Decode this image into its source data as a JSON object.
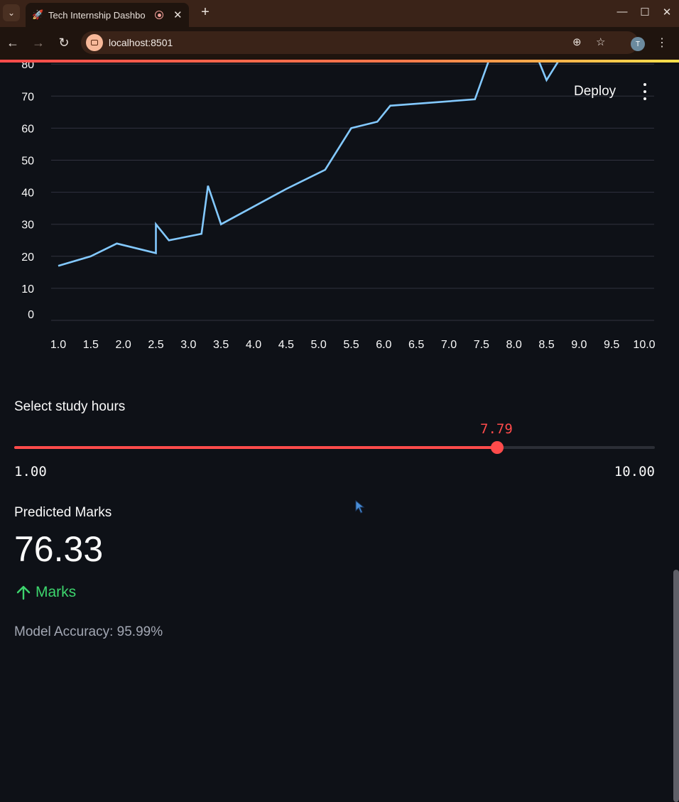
{
  "browser": {
    "tab_title": "Tech Internship Dashbo",
    "tab_favicon": "rocket-icon",
    "url": "localhost:8501",
    "profile_initial": "T"
  },
  "app": {
    "deploy_label": "Deploy"
  },
  "chart_data": {
    "type": "line",
    "x": [
      1.0,
      1.5,
      1.9,
      2.5,
      2.5,
      2.7,
      3.2,
      3.3,
      3.5,
      4.5,
      5.1,
      5.5,
      5.9,
      6.1,
      7.4,
      7.7,
      8.3,
      8.5,
      8.9
    ],
    "y": [
      17,
      20,
      24,
      21,
      30,
      25,
      27,
      42,
      30,
      41,
      47,
      60,
      62,
      67,
      69,
      86,
      85,
      75,
      88
    ],
    "xticks": [
      "1.0",
      "1.5",
      "2.0",
      "2.5",
      "3.0",
      "3.5",
      "4.0",
      "4.5",
      "5.0",
      "5.5",
      "6.0",
      "6.5",
      "7.0",
      "7.5",
      "8.0",
      "8.5",
      "9.0",
      "9.5",
      "10.0"
    ],
    "yticks": [
      "0",
      "10",
      "20",
      "30",
      "40",
      "50",
      "60",
      "70",
      "80"
    ],
    "xlim": [
      1.0,
      10.0
    ],
    "ylim": [
      0,
      80
    ],
    "grid": true,
    "color": "#83c9ff"
  },
  "slider": {
    "label": "Select study hours",
    "value": "7.79",
    "min": "1.00",
    "max": "10.00",
    "fraction": 0.7544,
    "color": "#ff4b4b"
  },
  "metric": {
    "label": "Predicted Marks",
    "value": "76.33",
    "delta": "Marks",
    "delta_color": "#3dd56d"
  },
  "accuracy_text": "Model Accuracy: 95.99%"
}
